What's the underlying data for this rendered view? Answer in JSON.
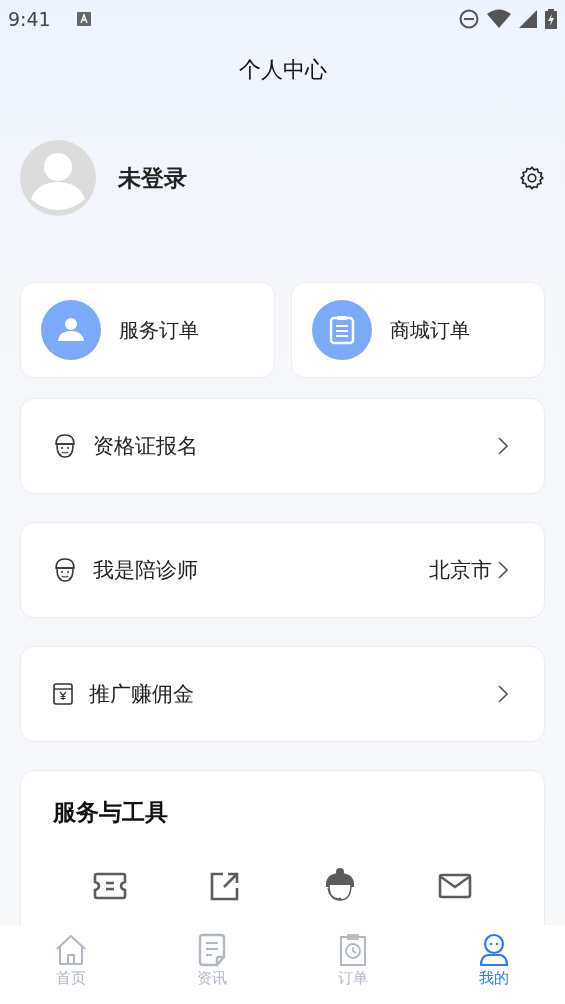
{
  "status_bar": {
    "time": "9:41"
  },
  "header": {
    "title": "个人中心"
  },
  "profile": {
    "name": "未登录"
  },
  "order_cards": [
    {
      "label": "服务订单",
      "kind": "person"
    },
    {
      "label": "商城订单",
      "kind": "clipboard"
    }
  ],
  "menu_rows": [
    {
      "label": "资格证报名",
      "kind": "worker"
    },
    {
      "label": "我是陪诊师",
      "kind": "worker",
      "value": "北京市"
    },
    {
      "label": "推广赚佣金",
      "kind": "wallet"
    }
  ],
  "tools_section": {
    "title": "服务与工具",
    "tools": [
      {
        "kind": "ticket"
      },
      {
        "kind": "share"
      },
      {
        "kind": "support"
      },
      {
        "kind": "mail"
      }
    ]
  },
  "tab_bar": [
    {
      "label": "首页",
      "kind": "home",
      "selected": false
    },
    {
      "label": "资讯",
      "kind": "news",
      "selected": false
    },
    {
      "label": "订单",
      "kind": "orders",
      "selected": false
    },
    {
      "label": "我的",
      "kind": "me",
      "selected": true
    }
  ]
}
